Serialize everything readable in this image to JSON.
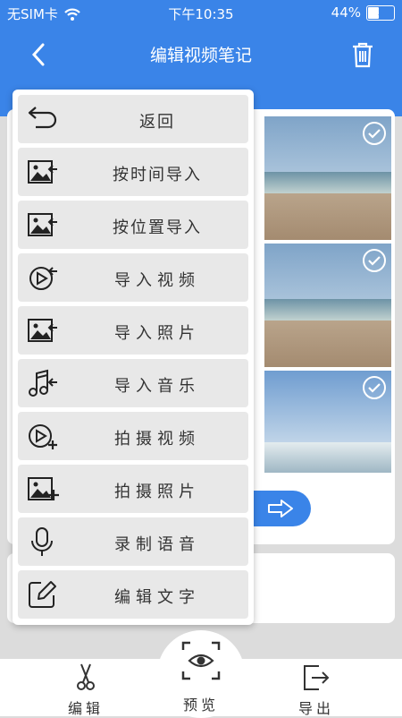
{
  "status": {
    "carrier": "无SIM卡",
    "time": "下午10:35",
    "battery": "44%"
  },
  "navbar": {
    "title": "编辑视频笔记"
  },
  "menu": {
    "items": [
      {
        "label": "返回",
        "icon": "undo-icon"
      },
      {
        "label": "按时间导入",
        "icon": "image-import-icon"
      },
      {
        "label": "按位置导入",
        "icon": "image-import-icon"
      },
      {
        "label": "导入视频",
        "icon": "video-import-icon"
      },
      {
        "label": "导入照片",
        "icon": "photo-import-icon"
      },
      {
        "label": "导入音乐",
        "icon": "music-import-icon"
      },
      {
        "label": "拍摄视频",
        "icon": "video-add-icon"
      },
      {
        "label": "拍摄照片",
        "icon": "photo-add-icon"
      },
      {
        "label": "录制语音",
        "icon": "microphone-icon"
      },
      {
        "label": "编辑文字",
        "icon": "edit-text-icon"
      }
    ]
  },
  "tabs": {
    "edit": "编辑",
    "preview": "预览",
    "export": "导出"
  },
  "colors": {
    "primary": "#3a84e8"
  }
}
